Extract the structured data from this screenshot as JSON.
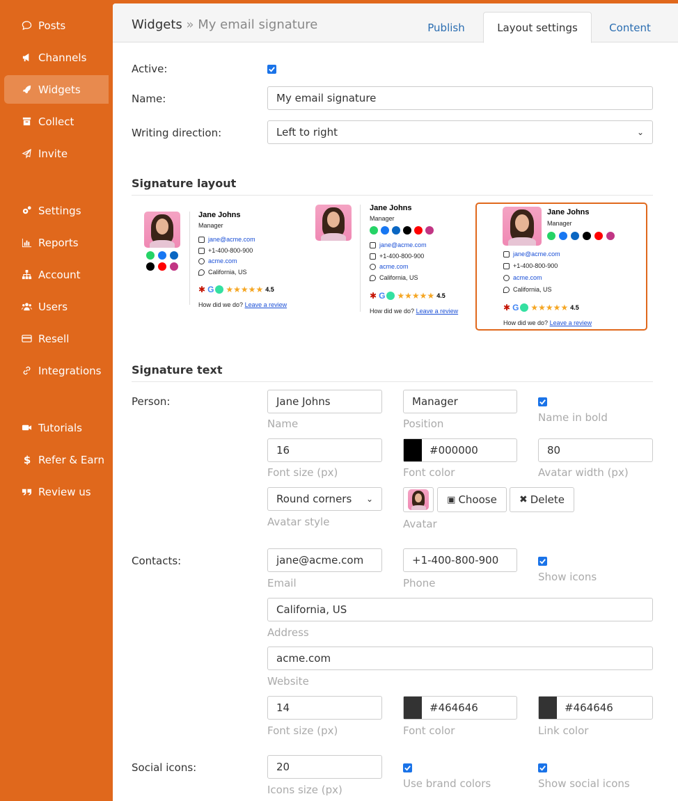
{
  "sidebar": {
    "items": [
      {
        "label": "Posts",
        "icon": "comment-icon"
      },
      {
        "label": "Channels",
        "icon": "megaphone-icon"
      },
      {
        "label": "Widgets",
        "icon": "rocket-icon",
        "active": true
      },
      {
        "label": "Collect",
        "icon": "archive-icon"
      },
      {
        "label": "Invite",
        "icon": "paper-plane-icon"
      },
      {
        "label": "Settings",
        "icon": "gears-icon"
      },
      {
        "label": "Reports",
        "icon": "bar-chart-icon"
      },
      {
        "label": "Account",
        "icon": "sitemap-icon"
      },
      {
        "label": "Users",
        "icon": "users-icon"
      },
      {
        "label": "Resell",
        "icon": "credit-card-icon"
      },
      {
        "label": "Integrations",
        "icon": "link-icon"
      },
      {
        "label": "Tutorials",
        "icon": "video-camera-icon"
      },
      {
        "label": "Refer & Earn",
        "icon": "dollar-icon"
      },
      {
        "label": "Review us",
        "icon": "quote-icon"
      }
    ]
  },
  "header": {
    "crumb_root": "Widgets",
    "crumb_sep": "»",
    "crumb_current": "My email signature",
    "tabs": [
      {
        "label": "Publish"
      },
      {
        "label": "Layout settings",
        "active": true
      },
      {
        "label": "Content"
      }
    ]
  },
  "form": {
    "active_label": "Active:",
    "name_label": "Name:",
    "name_value": "My email signature",
    "direction_label": "Writing direction:",
    "direction_value": "Left to right"
  },
  "layout_section": {
    "title": "Signature layout",
    "selected_index": 2
  },
  "signature": {
    "name": "Jane Johns",
    "position": "Manager",
    "email": "jane@acme.com",
    "phone": "+1-400-800-900",
    "website": "acme.com",
    "address": "California, US",
    "rating": "4.5",
    "review_prompt": "How did we do?",
    "review_link": "Leave a review"
  },
  "text_section": {
    "title": "Signature text",
    "person_label": "Person:",
    "person_name": "Jane Johns",
    "person_name_help": "Name",
    "person_position": "Manager",
    "person_position_help": "Position",
    "name_bold_help": "Name in bold",
    "font_size": "16",
    "font_size_help": "Font size (px)",
    "font_color": "#000000",
    "font_color_help": "Font color",
    "avatar_width": "80",
    "avatar_width_help": "Avatar width (px)",
    "avatar_style": "Round corners",
    "avatar_style_help": "Avatar style",
    "avatar_help": "Avatar",
    "choose_label": "Choose",
    "delete_label": "Delete",
    "contacts_label": "Contacts:",
    "email": "jane@acme.com",
    "email_help": "Email",
    "phone": "+1-400-800-900",
    "phone_help": "Phone",
    "show_icons_help": "Show icons",
    "address": "California, US",
    "address_help": "Address",
    "website": "acme.com",
    "website_help": "Website",
    "contacts_font_size": "14",
    "contacts_font_size_help": "Font size (px)",
    "contacts_font_color": "#464646",
    "contacts_font_color_help": "Font color",
    "link_color": "#464646",
    "link_color_help": "Link color",
    "social_label": "Social icons:",
    "icons_size": "20",
    "icons_size_help": "Icons size (px)",
    "brand_colors_help": "Use brand colors",
    "show_social_help": "Show social icons"
  },
  "colors": {
    "sidebar_bg": "#e0681c",
    "accent_link": "#2a6db1",
    "checkbox": "#1a73e8",
    "selected_border": "#e0681c"
  }
}
